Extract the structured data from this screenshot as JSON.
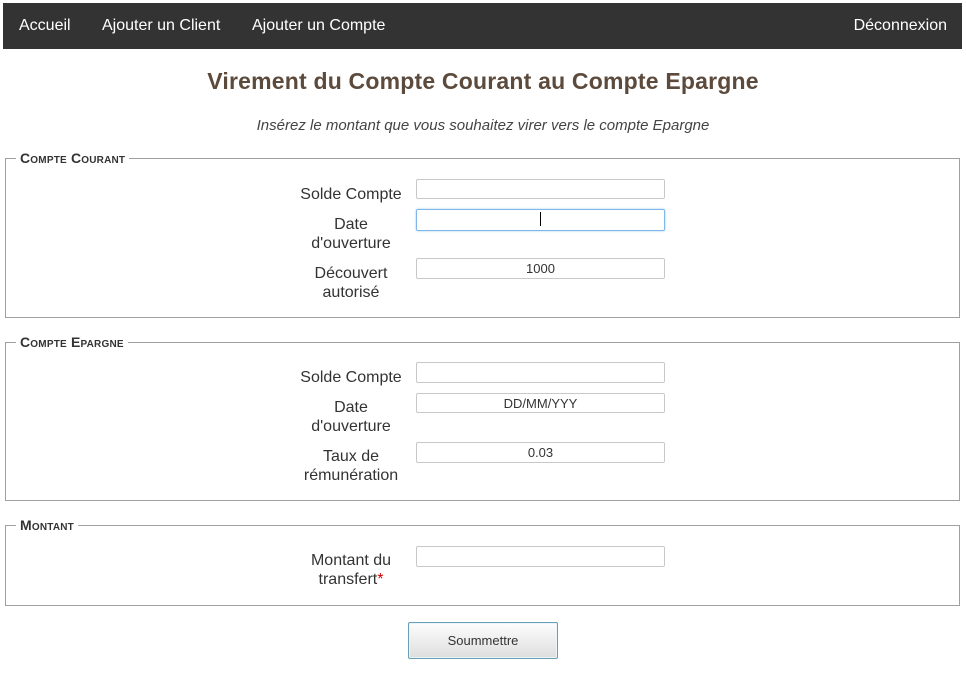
{
  "nav": {
    "accueil": "Accueil",
    "ajouter_client": "Ajouter un Client",
    "ajouter_compte": "Ajouter un Compte",
    "deconnexion": "Déconnexion"
  },
  "page": {
    "title": "Virement du Compte Courant au Compte Epargne",
    "subtitle": "Insérez le montant que vous souhaitez virer vers le compte Epargne"
  },
  "compte_courant": {
    "legend": "Compte Courant",
    "solde_label": "Solde Compte",
    "solde_value": "",
    "date_label_1": "Date",
    "date_label_2": "d'ouverture",
    "date_value": "",
    "decouvert_label_1": "Découvert",
    "decouvert_label_2": "autorisé",
    "decouvert_value": "1000"
  },
  "compte_epargne": {
    "legend": "Compte Epargne",
    "solde_label": "Solde Compte",
    "solde_value": "",
    "date_label_1": "Date",
    "date_label_2": "d'ouverture",
    "date_value": "DD/MM/YYY",
    "taux_label_1": "Taux de",
    "taux_label_2": "rémunération",
    "taux_value": "0.03"
  },
  "montant": {
    "legend": "Montant",
    "label_1": "Montant du",
    "label_2": "transfert",
    "required_mark": "*",
    "value": ""
  },
  "submit": {
    "label": "Soummettre"
  }
}
